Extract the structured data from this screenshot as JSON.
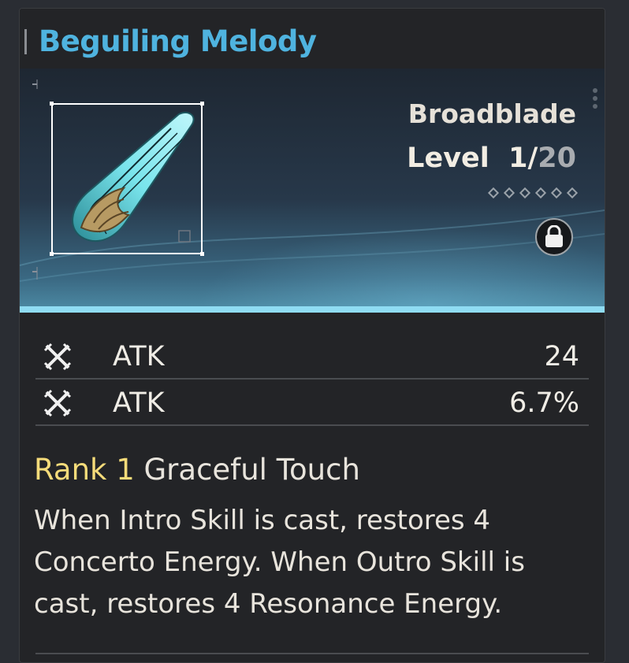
{
  "weapon": {
    "name": "Beguiling Melody",
    "type": "Broadblade",
    "level_label": "Level",
    "level_current": "1/",
    "level_max": "20",
    "rank_diamonds": 6,
    "locked": true
  },
  "stats": [
    {
      "icon": "atk-swords-icon",
      "name": "ATK",
      "value": "24"
    },
    {
      "icon": "atk-swords-icon",
      "name": "ATK",
      "value": "6.7%"
    }
  ],
  "passive": {
    "rank_label": "Rank 1",
    "name": "Graceful Touch",
    "description": "When Intro Skill is cast, restores 4 Concerto Energy. When Outro Skill is cast, restores 4 Resonance Energy."
  },
  "colors": {
    "title": "#4fb3df",
    "rank": "#f6dc7a",
    "accent_line": "#8fdcf3",
    "card_bg": "#232427"
  }
}
